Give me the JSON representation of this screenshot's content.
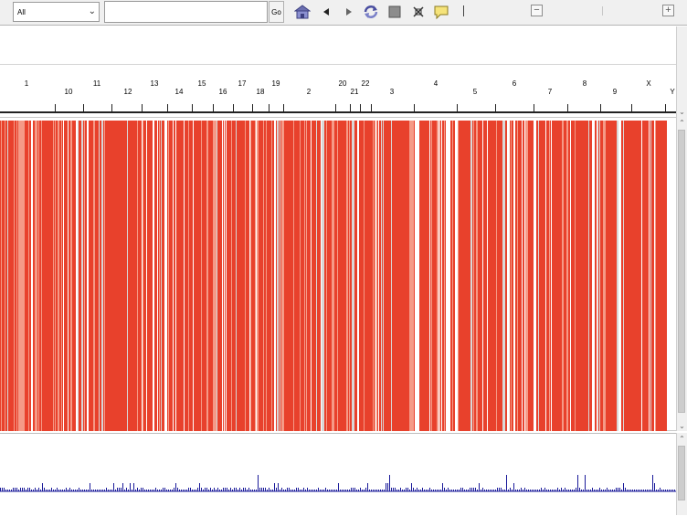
{
  "toolbar": {
    "genome_select": {
      "value": "All"
    },
    "locus_input": {
      "value": "",
      "placeholder": ""
    },
    "go_label": "Go",
    "icons": [
      "home-icon",
      "back-icon",
      "forward-icon",
      "refresh-icon",
      "region-of-interest-icon",
      "resize-to-window-icon",
      "popup-info-icon"
    ],
    "zoom_out_label": "−",
    "zoom_in_label": "+"
  },
  "ruler": {
    "chromosomes": [
      "1",
      "10",
      "11",
      "12",
      "13",
      "14",
      "15",
      "16",
      "17",
      "18",
      "19",
      "2",
      "20",
      "21",
      "22",
      "3",
      "4",
      "5",
      "6",
      "7",
      "8",
      "9",
      "X",
      "Y"
    ]
  },
  "colors": {
    "track_red": "#e8412c",
    "track_light": "#f59a87",
    "track_gap": "#d8d8d8",
    "coverage_blue": "#1a1a9a"
  }
}
